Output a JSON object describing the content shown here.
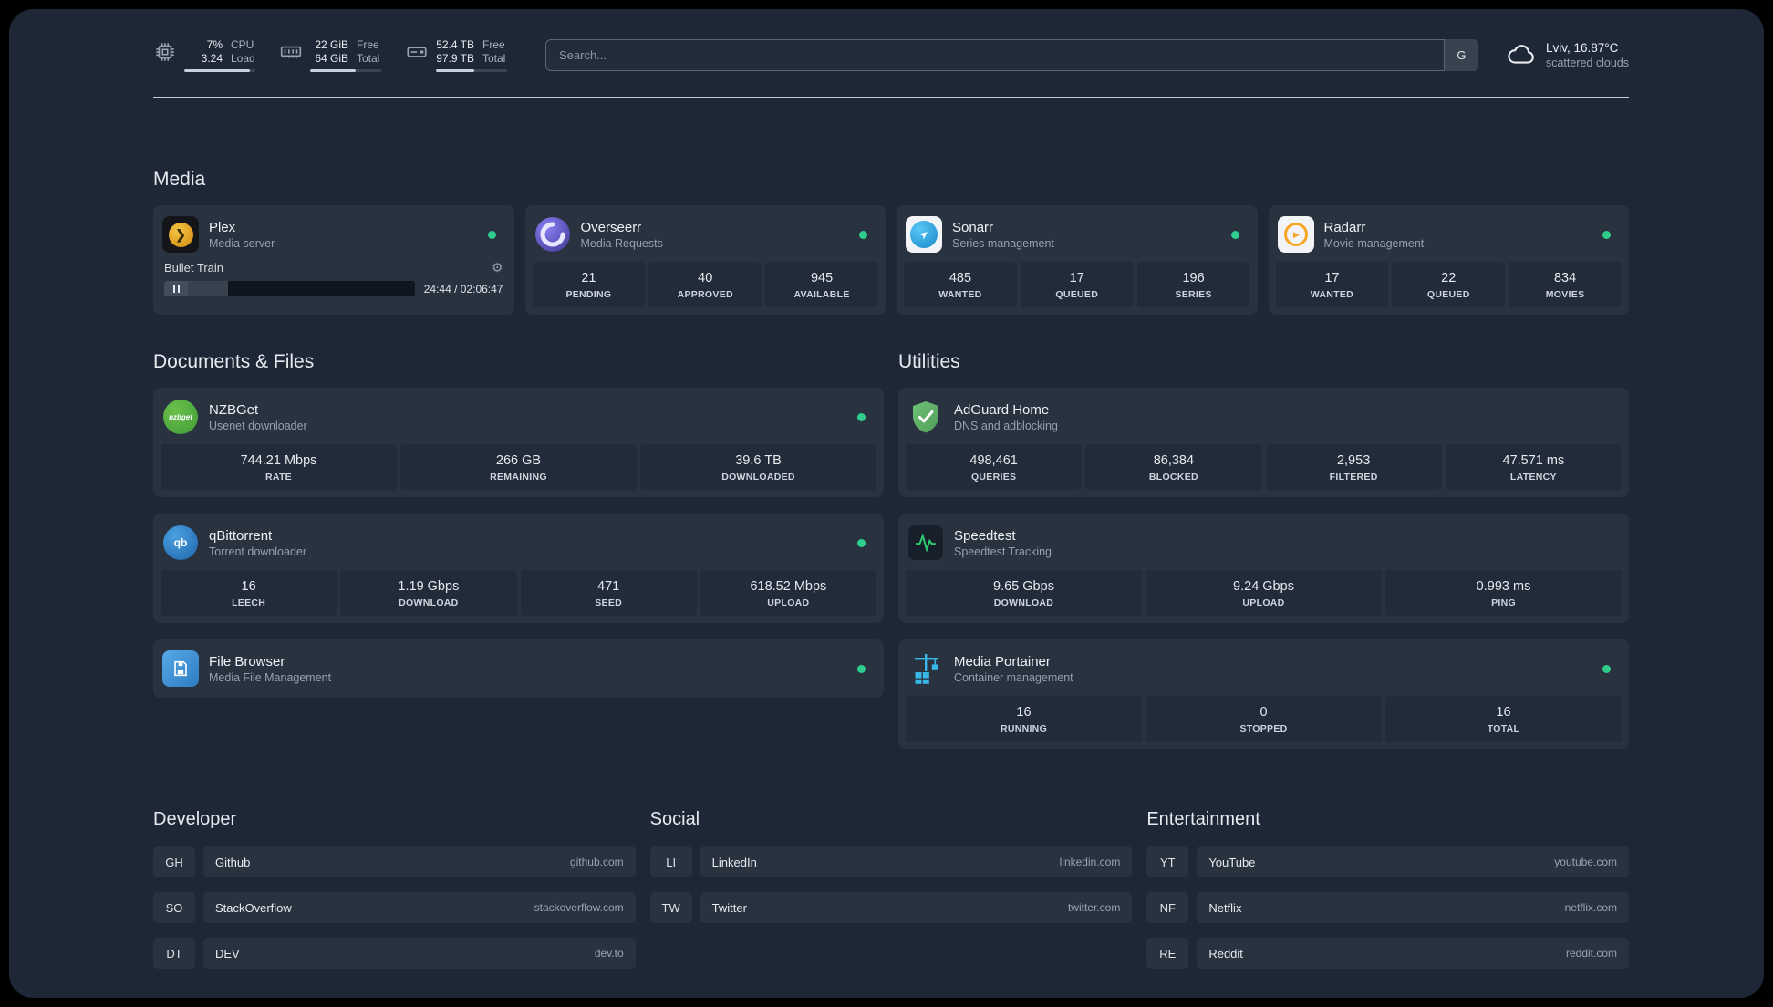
{
  "topbar": {
    "cpu": {
      "value_top": "7%",
      "value_bottom": "3.24",
      "label_top": "CPU",
      "label_bottom": "Load",
      "bar_percent": 92
    },
    "ram": {
      "value_top": "22 GiB",
      "value_bottom": "64 GiB",
      "label_top": "Free",
      "label_bottom": "Total",
      "bar_percent": 64
    },
    "disk": {
      "value_top": "52.4 TB",
      "value_bottom": "97.9 TB",
      "label_top": "Free",
      "label_bottom": "Total",
      "bar_percent": 54
    },
    "search": {
      "placeholder": "Search...",
      "button_label": "G"
    },
    "weather": {
      "location": "Lviv, 16.87°C",
      "condition": "scattered clouds"
    }
  },
  "sections": {
    "media": "Media",
    "documents": "Documents & Files",
    "utilities": "Utilities"
  },
  "apps": {
    "plex": {
      "name": "Plex",
      "subtitle": "Media server",
      "status": "online",
      "player": {
        "track": "Bullet Train",
        "time": "24:44 / 02:06:47",
        "progress_percent": 16
      }
    },
    "overseerr": {
      "name": "Overseerr",
      "subtitle": "Media Requests",
      "status": "online",
      "stats": [
        {
          "value": "21",
          "label": "PENDING"
        },
        {
          "value": "40",
          "label": "APPROVED"
        },
        {
          "value": "945",
          "label": "AVAILABLE"
        }
      ]
    },
    "sonarr": {
      "name": "Sonarr",
      "subtitle": "Series management",
      "status": "online",
      "stats": [
        {
          "value": "485",
          "label": "WANTED"
        },
        {
          "value": "17",
          "label": "QUEUED"
        },
        {
          "value": "196",
          "label": "SERIES"
        }
      ]
    },
    "radarr": {
      "name": "Radarr",
      "subtitle": "Movie management",
      "status": "online",
      "stats": [
        {
          "value": "17",
          "label": "WANTED"
        },
        {
          "value": "22",
          "label": "QUEUED"
        },
        {
          "value": "834",
          "label": "MOVIES"
        }
      ]
    },
    "nzbget": {
      "name": "NZBGet",
      "subtitle": "Usenet downloader",
      "status": "online",
      "stats": [
        {
          "value": "744.21 Mbps",
          "label": "RATE"
        },
        {
          "value": "266 GB",
          "label": "REMAINING"
        },
        {
          "value": "39.6 TB",
          "label": "DOWNLOADED"
        }
      ]
    },
    "qbittorrent": {
      "name": "qBittorrent",
      "subtitle": "Torrent downloader",
      "status": "online",
      "stats": [
        {
          "value": "16",
          "label": "LEECH"
        },
        {
          "value": "1.19 Gbps",
          "label": "DOWNLOAD"
        },
        {
          "value": "471",
          "label": "SEED"
        },
        {
          "value": "618.52 Mbps",
          "label": "UPLOAD"
        }
      ]
    },
    "filebrowser": {
      "name": "File Browser",
      "subtitle": "Media File Management",
      "status": "online"
    },
    "adguard": {
      "name": "AdGuard Home",
      "subtitle": "DNS and adblocking",
      "stats": [
        {
          "value": "498,461",
          "label": "QUERIES"
        },
        {
          "value": "86,384",
          "label": "BLOCKED"
        },
        {
          "value": "2,953",
          "label": "FILTERED"
        },
        {
          "value": "47.571 ms",
          "label": "LATENCY"
        }
      ]
    },
    "speedtest": {
      "name": "Speedtest",
      "subtitle": "Speedtest Tracking",
      "stats": [
        {
          "value": "9.65 Gbps",
          "label": "DOWNLOAD"
        },
        {
          "value": "9.24 Gbps",
          "label": "UPLOAD"
        },
        {
          "value": "0.993 ms",
          "label": "PING"
        }
      ]
    },
    "portainer": {
      "name": "Media Portainer",
      "subtitle": "Container management",
      "status": "online",
      "stats": [
        {
          "value": "16",
          "label": "RUNNING"
        },
        {
          "value": "0",
          "label": "STOPPED"
        },
        {
          "value": "16",
          "label": "TOTAL"
        }
      ]
    }
  },
  "bookmarks": {
    "developer": {
      "heading": "Developer",
      "items": [
        {
          "abbr": "GH",
          "name": "Github",
          "url": "github.com"
        },
        {
          "abbr": "SO",
          "name": "StackOverflow",
          "url": "stackoverflow.com"
        },
        {
          "abbr": "DT",
          "name": "DEV",
          "url": "dev.to"
        }
      ]
    },
    "social": {
      "heading": "Social",
      "items": [
        {
          "abbr": "LI",
          "name": "LinkedIn",
          "url": "linkedin.com"
        },
        {
          "abbr": "TW",
          "name": "Twitter",
          "url": "twitter.com"
        }
      ]
    },
    "entertainment": {
      "heading": "Entertainment",
      "items": [
        {
          "abbr": "YT",
          "name": "YouTube",
          "url": "youtube.com"
        },
        {
          "abbr": "NF",
          "name": "Netflix",
          "url": "netflix.com"
        },
        {
          "abbr": "RE",
          "name": "Reddit",
          "url": "reddit.com"
        }
      ]
    }
  },
  "icons": {
    "gear": "⚙",
    "plex_chevron": "❯",
    "sonarr_arrow": "➤",
    "radarr_play": "▶",
    "nzbget_text": "nzbget",
    "qbittorrent_text": "qb"
  },
  "colors": {
    "status_online": "#2fce8e",
    "panel_background": "#1d2736",
    "card_background": "#29323f"
  }
}
